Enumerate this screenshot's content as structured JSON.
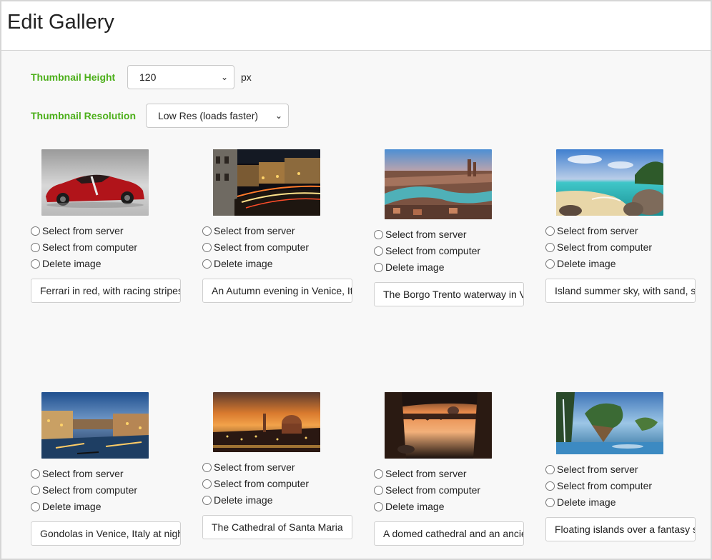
{
  "header": {
    "title": "Edit Gallery"
  },
  "settings": {
    "thumbnail_height": {
      "label": "Thumbnail Height",
      "value": "120",
      "unit": "px"
    },
    "thumbnail_resolution": {
      "label": "Thumbnail Resolution",
      "value": "Low Res (loads faster)"
    }
  },
  "options": {
    "select_server": "Select from server",
    "select_computer": "Select from computer",
    "delete_image": "Delete image"
  },
  "gallery": [
    {
      "caption": "Ferrari in red, with racing stripes",
      "image": "red-sports-car"
    },
    {
      "caption": "An Autumn evening in Venice, Italy",
      "image": "venice-canal-night"
    },
    {
      "caption": "The Borgo Trento waterway in Verona",
      "image": "verona-river-city"
    },
    {
      "caption": "Island summer sky, with sand, sea and rocks",
      "image": "tropical-beach"
    },
    {
      "caption": "Gondolas in Venice, Italy at night",
      "image": "venice-grand-canal"
    },
    {
      "caption": "The Cathedral of Santa Maria",
      "image": "florence-cathedral-sunset"
    },
    {
      "caption": "A domed cathedral and an ancient bridge",
      "image": "rome-river-sunset"
    },
    {
      "caption": "Floating islands over a fantasy sea",
      "image": "fantasy-floating-islands"
    }
  ]
}
